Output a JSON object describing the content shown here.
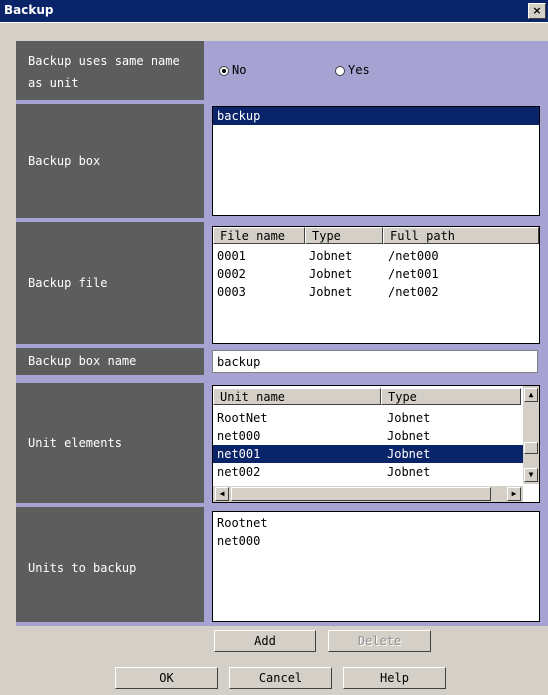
{
  "window": {
    "title": "Backup",
    "close_glyph": "×"
  },
  "same_name": {
    "label_line1": "Backup uses same name",
    "label_line2": "as unit",
    "options": [
      {
        "label": "No",
        "selected": true
      },
      {
        "label": "Yes",
        "selected": false
      }
    ]
  },
  "backup_box": {
    "label": "Backup box",
    "items": [
      "backup"
    ]
  },
  "backup_file": {
    "label": "Backup file",
    "columns": [
      "File name",
      "Type",
      "Full path"
    ],
    "rows": [
      [
        "0001",
        "Jobnet",
        "/net000"
      ],
      [
        "0002",
        "Jobnet",
        "/net001"
      ],
      [
        "0003",
        "Jobnet",
        "/net002"
      ]
    ]
  },
  "box_name": {
    "label": "Backup box name",
    "value": "backup"
  },
  "unit_elements": {
    "label": "Unit elements",
    "columns": [
      "Unit name",
      "Type"
    ],
    "rows": [
      [
        "RootNet",
        "Jobnet"
      ],
      [
        "net000",
        "Jobnet"
      ],
      [
        "net001",
        "Jobnet"
      ],
      [
        "net002",
        "Jobnet"
      ]
    ],
    "selected_row": "net001"
  },
  "units_to_backup": {
    "label": "Units to backup",
    "items": [
      "Rootnet",
      "net000"
    ]
  },
  "buttons": {
    "add": "Add",
    "delete": "Delete",
    "ok": "OK",
    "cancel": "Cancel",
    "help": "Help"
  },
  "colors": {
    "titlebar": "#0a246a",
    "label_bg": "#5d5d5d",
    "form_bg": "#a6a3d3",
    "selection": "#0a246a"
  }
}
